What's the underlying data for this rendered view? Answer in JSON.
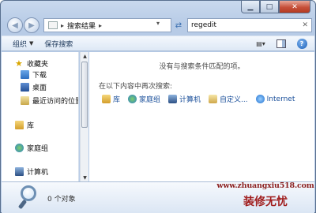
{
  "address": {
    "crumb": "搜索结果",
    "separator": "▸"
  },
  "search": {
    "value": "regedit"
  },
  "toolbar": {
    "organize": "组织",
    "save_search": "保存搜索"
  },
  "sidebar": {
    "items": [
      {
        "label": "收藏夹"
      },
      {
        "label": "下载"
      },
      {
        "label": "桌面"
      },
      {
        "label": "最近访问的位置"
      },
      {
        "label": "库"
      },
      {
        "label": "家庭组"
      },
      {
        "label": "计算机"
      }
    ]
  },
  "main": {
    "no_results": "没有与搜索条件匹配的项。",
    "search_again": "在以下内容中再次搜索:",
    "options": [
      {
        "label": "库"
      },
      {
        "label": "家庭组"
      },
      {
        "label": "计算机"
      },
      {
        "label": "自定义..."
      },
      {
        "label": "Internet"
      }
    ]
  },
  "status": {
    "count": "0 个对象"
  },
  "watermark": {
    "url": "www.zhuangxiu518.com",
    "brand": "装修无忧"
  },
  "colors": {
    "link": "#1a4f9a",
    "frame": "#b9cde8",
    "watermark": "#8b1f1f"
  }
}
